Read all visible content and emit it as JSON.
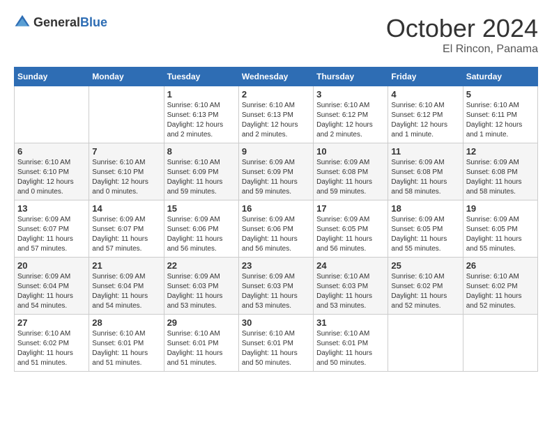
{
  "header": {
    "logo_general": "General",
    "logo_blue": "Blue",
    "month": "October 2024",
    "location": "El Rincon, Panama"
  },
  "weekdays": [
    "Sunday",
    "Monday",
    "Tuesday",
    "Wednesday",
    "Thursday",
    "Friday",
    "Saturday"
  ],
  "weeks": [
    [
      {
        "day": "",
        "info": ""
      },
      {
        "day": "",
        "info": ""
      },
      {
        "day": "1",
        "info": "Sunrise: 6:10 AM\nSunset: 6:13 PM\nDaylight: 12 hours and 2 minutes."
      },
      {
        "day": "2",
        "info": "Sunrise: 6:10 AM\nSunset: 6:13 PM\nDaylight: 12 hours and 2 minutes."
      },
      {
        "day": "3",
        "info": "Sunrise: 6:10 AM\nSunset: 6:12 PM\nDaylight: 12 hours and 2 minutes."
      },
      {
        "day": "4",
        "info": "Sunrise: 6:10 AM\nSunset: 6:12 PM\nDaylight: 12 hours and 1 minute."
      },
      {
        "day": "5",
        "info": "Sunrise: 6:10 AM\nSunset: 6:11 PM\nDaylight: 12 hours and 1 minute."
      }
    ],
    [
      {
        "day": "6",
        "info": "Sunrise: 6:10 AM\nSunset: 6:10 PM\nDaylight: 12 hours and 0 minutes."
      },
      {
        "day": "7",
        "info": "Sunrise: 6:10 AM\nSunset: 6:10 PM\nDaylight: 12 hours and 0 minutes."
      },
      {
        "day": "8",
        "info": "Sunrise: 6:10 AM\nSunset: 6:09 PM\nDaylight: 11 hours and 59 minutes."
      },
      {
        "day": "9",
        "info": "Sunrise: 6:09 AM\nSunset: 6:09 PM\nDaylight: 11 hours and 59 minutes."
      },
      {
        "day": "10",
        "info": "Sunrise: 6:09 AM\nSunset: 6:08 PM\nDaylight: 11 hours and 59 minutes."
      },
      {
        "day": "11",
        "info": "Sunrise: 6:09 AM\nSunset: 6:08 PM\nDaylight: 11 hours and 58 minutes."
      },
      {
        "day": "12",
        "info": "Sunrise: 6:09 AM\nSunset: 6:08 PM\nDaylight: 11 hours and 58 minutes."
      }
    ],
    [
      {
        "day": "13",
        "info": "Sunrise: 6:09 AM\nSunset: 6:07 PM\nDaylight: 11 hours and 57 minutes."
      },
      {
        "day": "14",
        "info": "Sunrise: 6:09 AM\nSunset: 6:07 PM\nDaylight: 11 hours and 57 minutes."
      },
      {
        "day": "15",
        "info": "Sunrise: 6:09 AM\nSunset: 6:06 PM\nDaylight: 11 hours and 56 minutes."
      },
      {
        "day": "16",
        "info": "Sunrise: 6:09 AM\nSunset: 6:06 PM\nDaylight: 11 hours and 56 minutes."
      },
      {
        "day": "17",
        "info": "Sunrise: 6:09 AM\nSunset: 6:05 PM\nDaylight: 11 hours and 56 minutes."
      },
      {
        "day": "18",
        "info": "Sunrise: 6:09 AM\nSunset: 6:05 PM\nDaylight: 11 hours and 55 minutes."
      },
      {
        "day": "19",
        "info": "Sunrise: 6:09 AM\nSunset: 6:05 PM\nDaylight: 11 hours and 55 minutes."
      }
    ],
    [
      {
        "day": "20",
        "info": "Sunrise: 6:09 AM\nSunset: 6:04 PM\nDaylight: 11 hours and 54 minutes."
      },
      {
        "day": "21",
        "info": "Sunrise: 6:09 AM\nSunset: 6:04 PM\nDaylight: 11 hours and 54 minutes."
      },
      {
        "day": "22",
        "info": "Sunrise: 6:09 AM\nSunset: 6:03 PM\nDaylight: 11 hours and 53 minutes."
      },
      {
        "day": "23",
        "info": "Sunrise: 6:09 AM\nSunset: 6:03 PM\nDaylight: 11 hours and 53 minutes."
      },
      {
        "day": "24",
        "info": "Sunrise: 6:10 AM\nSunset: 6:03 PM\nDaylight: 11 hours and 53 minutes."
      },
      {
        "day": "25",
        "info": "Sunrise: 6:10 AM\nSunset: 6:02 PM\nDaylight: 11 hours and 52 minutes."
      },
      {
        "day": "26",
        "info": "Sunrise: 6:10 AM\nSunset: 6:02 PM\nDaylight: 11 hours and 52 minutes."
      }
    ],
    [
      {
        "day": "27",
        "info": "Sunrise: 6:10 AM\nSunset: 6:02 PM\nDaylight: 11 hours and 51 minutes."
      },
      {
        "day": "28",
        "info": "Sunrise: 6:10 AM\nSunset: 6:01 PM\nDaylight: 11 hours and 51 minutes."
      },
      {
        "day": "29",
        "info": "Sunrise: 6:10 AM\nSunset: 6:01 PM\nDaylight: 11 hours and 51 minutes."
      },
      {
        "day": "30",
        "info": "Sunrise: 6:10 AM\nSunset: 6:01 PM\nDaylight: 11 hours and 50 minutes."
      },
      {
        "day": "31",
        "info": "Sunrise: 6:10 AM\nSunset: 6:01 PM\nDaylight: 11 hours and 50 minutes."
      },
      {
        "day": "",
        "info": ""
      },
      {
        "day": "",
        "info": ""
      }
    ]
  ]
}
